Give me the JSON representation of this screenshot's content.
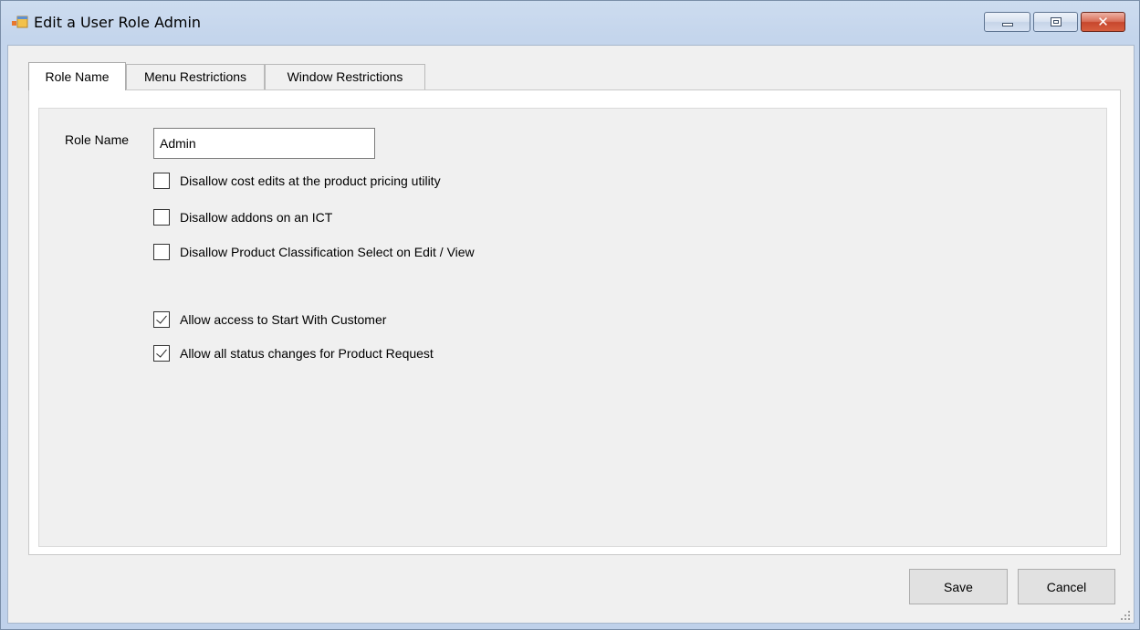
{
  "window": {
    "title": "Edit a User Role Admin",
    "icon": "app-window-icon",
    "controls": [
      "minimize-icon",
      "restore-icon",
      "close-icon"
    ],
    "close_glyph": "✕"
  },
  "tabs": [
    {
      "label": "Role Name",
      "active": true
    },
    {
      "label": "Menu Restrictions",
      "active": false
    },
    {
      "label": "Window Restrictions",
      "active": false
    }
  ],
  "form": {
    "role_name_label": "Role Name",
    "role_name_value": "Admin",
    "checkboxes": [
      {
        "label": "Disallow cost edits at the product pricing utility",
        "checked": false
      },
      {
        "label": "Disallow addons on an ICT",
        "checked": false
      },
      {
        "label": "Disallow Product Classification Select on Edit / View",
        "checked": false
      },
      {
        "label": "Allow access to Start With Customer",
        "checked": true
      },
      {
        "label": "Allow all status changes for Product Request",
        "checked": true
      }
    ]
  },
  "buttons": {
    "save": "Save",
    "cancel": "Cancel"
  },
  "colors": {
    "title_bar": "#c4d5ec",
    "close_button": "#c7472d",
    "client_bg": "#f0f0f0"
  }
}
